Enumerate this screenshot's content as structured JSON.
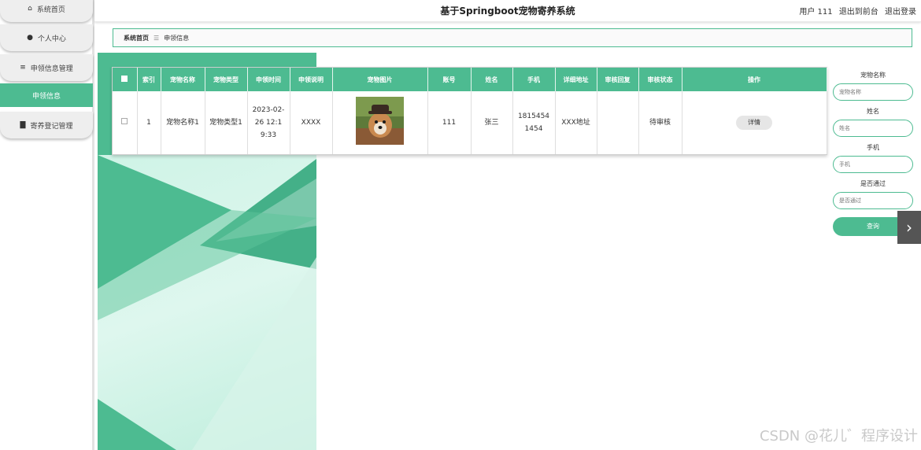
{
  "header": {
    "title": "基于Springboot宠物寄养系统",
    "user": "用户 111",
    "exit_front": "退出到前台",
    "logout": "退出登录"
  },
  "sidebar": {
    "items": [
      {
        "label": "系统首页",
        "icon": "home-icon",
        "glyph": "⌂"
      },
      {
        "label": "个人中心",
        "icon": "user-icon",
        "glyph": "●"
      },
      {
        "label": "申领信息管理",
        "icon": "list-icon",
        "glyph": "≡"
      },
      {
        "label": "申领信息",
        "icon": "",
        "glyph": ""
      },
      {
        "label": "寄养登记管理",
        "icon": "clipboard-icon",
        "glyph": "▇"
      }
    ]
  },
  "breadcrumb": {
    "home": "系统首页",
    "sep": "☰",
    "current": "申领信息"
  },
  "table": {
    "headers": [
      "索引",
      "宠物名称",
      "宠物类型",
      "申领时间",
      "申领说明",
      "宠物图片",
      "账号",
      "姓名",
      "手机",
      "详细地址",
      "审核回复",
      "审核状态",
      "操作"
    ],
    "rows": [
      {
        "index": "1",
        "pet_name": "宠物名称1",
        "pet_type": "宠物类型1",
        "claim_time": "2023-02-26 12:19:33",
        "claim_desc": "XXXX",
        "account": "111",
        "name": "张三",
        "phone": "18154541454",
        "address": "XXX地址",
        "reply": "",
        "status": "待审核",
        "action": "详情"
      }
    ]
  },
  "search": {
    "pet_name_label": "宠物名称",
    "pet_name_placeholder": "宠物名称",
    "name_label": "姓名",
    "name_placeholder": "姓名",
    "phone_label": "手机",
    "phone_placeholder": "手机",
    "passed_label": "是否通过",
    "passed_placeholder": "是否通过",
    "query_button": "查询"
  },
  "watermark": "CSDN @花儿゛程序设计",
  "colors": {
    "accent": "#4dbb91",
    "accent_light": "#c6f1e2"
  }
}
